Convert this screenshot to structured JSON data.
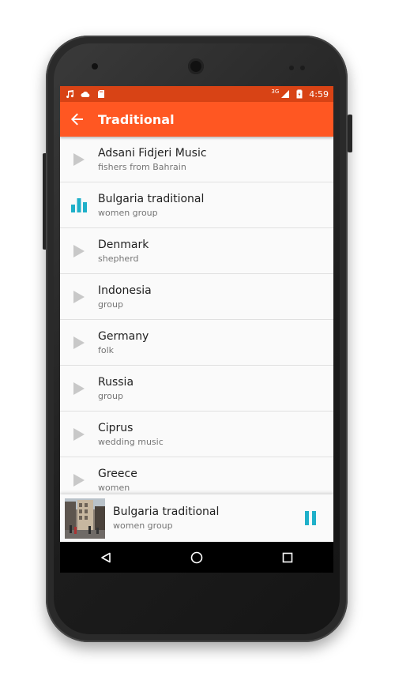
{
  "status_bar": {
    "time": "4:59",
    "network": "3G",
    "left_icons": [
      "music-note-icon",
      "cloud-icon",
      "sd-card-icon"
    ],
    "right_icons": [
      "signal-icon",
      "battery-icon"
    ]
  },
  "toolbar": {
    "title": "Traditional",
    "back_icon": "arrow-back-icon",
    "color": "#ff5722",
    "status_color": "#d84315"
  },
  "tracks": [
    {
      "title": "Adsani Fidjeri Music",
      "subtitle": "fishers from Bahrain",
      "state": "play"
    },
    {
      "title": "Bulgaria traditional",
      "subtitle": "women group",
      "state": "playing"
    },
    {
      "title": "Denmark",
      "subtitle": "shepherd",
      "state": "play"
    },
    {
      "title": "Indonesia",
      "subtitle": "group",
      "state": "play"
    },
    {
      "title": "Germany",
      "subtitle": "folk",
      "state": "play"
    },
    {
      "title": "Russia",
      "subtitle": "group",
      "state": "play"
    },
    {
      "title": "Ciprus",
      "subtitle": "wedding music",
      "state": "play"
    },
    {
      "title": "Greece",
      "subtitle": "women",
      "state": "play"
    }
  ],
  "now_playing": {
    "title": "Bulgaria traditional",
    "subtitle": "women group",
    "control_icon": "pause-icon",
    "accent": "#1fb0c9"
  },
  "nav_bar": {
    "buttons": [
      "back-triangle-icon",
      "home-circle-icon",
      "recents-square-icon"
    ]
  }
}
